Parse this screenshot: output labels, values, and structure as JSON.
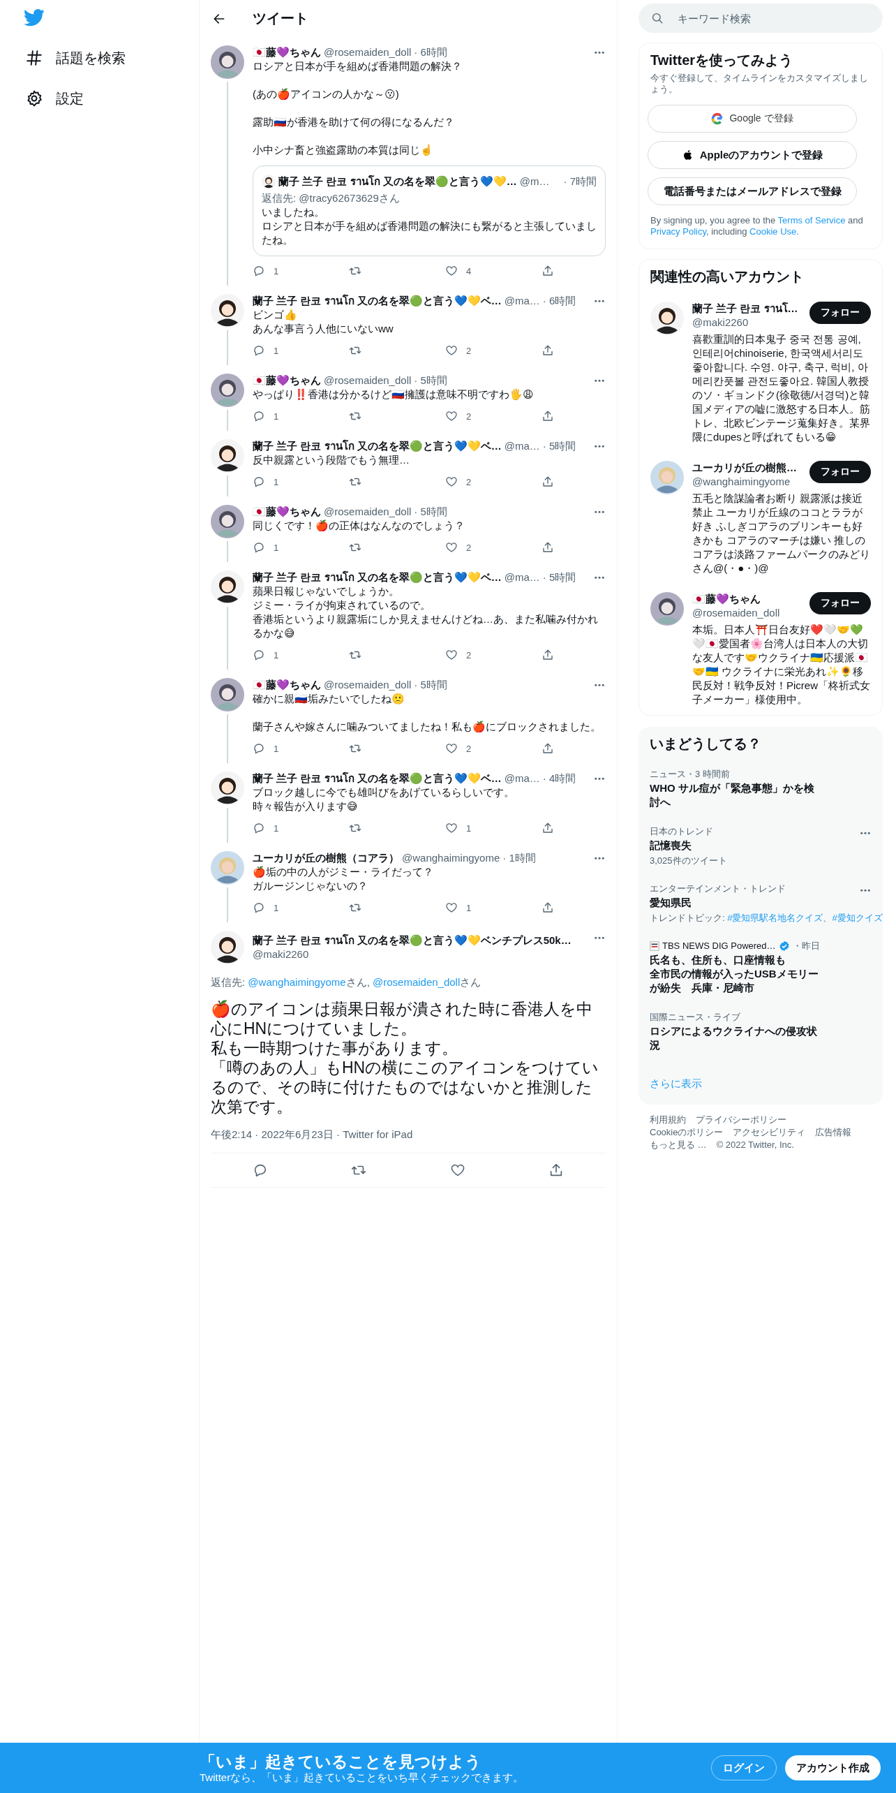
{
  "sidebar": {
    "items": [
      {
        "label": "話題を検索",
        "kind": "hashtag"
      },
      {
        "label": "設定",
        "kind": "settings"
      }
    ]
  },
  "header": {
    "title": "ツイート"
  },
  "thread": [
    {
      "avatar": {
        "kind": "doll"
      },
      "name": "🇯🇵藤💜ちゃん",
      "handle": "@rosemaiden_doll",
      "time": "· 6時間",
      "text": [
        [
          "ロシアと日本が手を組めば香港問題の解決？"
        ],
        [
          "(あの🍎アイコンの人かな～😗)"
        ],
        [
          "露助🇷🇺が香港を助けて何の得になるんだ？"
        ],
        [
          "小中シナ畜と強盗露助の本質は同じ☝️"
        ]
      ],
      "quote": {
        "avatar": {
          "kind": "maki"
        },
        "name": "蘭子 兰子 란코 รานโก 又の名を翠🟢と言う💙💛…",
        "handle": "@m…",
        "time": "· 7時間",
        "reply_to": "返信先: @tracy62673629さん",
        "text": [
          [
            "いましたね。",
            "ロシアと日本が手を組めば香港問題の解決にも繋がると主張していましたね。"
          ]
        ]
      },
      "replies": "1",
      "likes": "4"
    },
    {
      "avatar": {
        "kind": "maki"
      },
      "name": "蘭子 兰子 란코 รานโก 又の名を翠🟢と言う💙💛ベ…",
      "handle": "@ma…",
      "time": "· 6時間",
      "text": [
        [
          "ビンゴ👍",
          "あんな事言う人他にいないww"
        ]
      ],
      "replies": "1",
      "likes": "2"
    },
    {
      "avatar": {
        "kind": "doll"
      },
      "name": "🇯🇵藤💜ちゃん",
      "handle": "@rosemaiden_doll",
      "time": "· 5時間",
      "text": [
        [
          "やっぱり‼️香港は分かるけど🇷🇺擁護は意味不明ですわ🖐😩"
        ]
      ],
      "replies": "1",
      "likes": "2"
    },
    {
      "avatar": {
        "kind": "maki"
      },
      "name": "蘭子 兰子 란코 รานโก 又の名を翠🟢と言う💙💛ベ…",
      "handle": "@ma…",
      "time": "· 5時間",
      "text": [
        [
          "反中親露という段階でもう無理…"
        ]
      ],
      "replies": "1",
      "likes": "2"
    },
    {
      "avatar": {
        "kind": "doll"
      },
      "name": "🇯🇵藤💜ちゃん",
      "handle": "@rosemaiden_doll",
      "time": "· 5時間",
      "text": [
        [
          "同じくです！🍎の正体はなんなのでしょう？"
        ]
      ],
      "replies": "1",
      "likes": "2"
    },
    {
      "avatar": {
        "kind": "maki"
      },
      "name": "蘭子 兰子 란코 รานโก 又の名を翠🟢と言う💙💛ベ…",
      "handle": "@ma…",
      "time": "· 5時間",
      "text": [
        [
          "蘋果日報じゃないでしょうか。",
          "ジミー・ライが拘束されているので。",
          "香港垢というより親露垢にしか見えませんけどね…あ、また私噛み付かれるかな😅"
        ]
      ],
      "replies": "1",
      "likes": "2"
    },
    {
      "avatar": {
        "kind": "doll"
      },
      "name": "🇯🇵藤💜ちゃん",
      "handle": "@rosemaiden_doll",
      "time": "· 5時間",
      "text": [
        [
          "確かに親🇷🇺垢みたいでしたね🙁"
        ],
        [
          "蘭子さんや嫁さんに噛みついてましたね！私も🍎にブロックされました。"
        ]
      ],
      "replies": "1",
      "likes": "2"
    },
    {
      "avatar": {
        "kind": "maki"
      },
      "name": "蘭子 兰子 란코 รานโก 又の名を翠🟢と言う💙💛ベ…",
      "handle": "@ma…",
      "time": "· 4時間",
      "text": [
        [
          "ブロック越しに今でも雄叫びをあげているらしいです。",
          "時々報告が入ります😅"
        ]
      ],
      "replies": "1",
      "likes": "1"
    },
    {
      "avatar": {
        "kind": "koala"
      },
      "name": "ユーカリが丘の樹熊（コアラ）",
      "handle": "@wanghaimingyome",
      "time": "· 1時間",
      "text": [
        [
          "🍎垢の中の人がジミー・ライだって？",
          "ガルージンじゃないの？"
        ]
      ],
      "replies": "1",
      "likes": "1"
    }
  ],
  "focused": {
    "avatar": {
      "kind": "maki"
    },
    "name": "蘭子 兰子 란코 รานโก 又の名を翠🟢と言う💙💛ベンチプレス50k…",
    "handle": "@maki2260",
    "reply_to": [
      {
        "text": "返信先: ",
        "link": false
      },
      {
        "text": "@wanghaimingyome",
        "link": true
      },
      {
        "text": "さん, ",
        "link": false
      },
      {
        "text": "@rosemaiden_doll",
        "link": true
      },
      {
        "text": "さん",
        "link": false
      }
    ],
    "text": [
      [
        "🍎のアイコンは蘋果日報が潰された時に香港人を中心にHNにつけていました。",
        "私も一時期つけた事があります。",
        "「噂のあの人」もHNの横にこのアイコンをつけているので、その時に付けたものではないかと推測した次第です。"
      ]
    ],
    "meta": "午後2:14 · 2022年6月23日 · Twitter for iPad"
  },
  "search": {
    "placeholder": "キーワード検索"
  },
  "signup": {
    "title": "Twitterを使ってみよう",
    "subtitle": "今すぐ登録して、タイムラインをカスタマイズしましょう。",
    "buttons": [
      {
        "label": "Google で登録",
        "kind": "google"
      },
      {
        "label": "Appleのアカウントで登録",
        "kind": "apple"
      },
      {
        "label": "電話番号またはメールアドレスで登録",
        "kind": "plain"
      }
    ],
    "legal": [
      {
        "text": "By signing up, you agree to the ",
        "link": false
      },
      {
        "text": "Terms of Service",
        "link": true
      },
      {
        "text": " and ",
        "link": false
      },
      {
        "text": "Privacy Policy",
        "link": true
      },
      {
        "text": ", including ",
        "link": false
      },
      {
        "text": "Cookie Use.",
        "link": true
      }
    ]
  },
  "recommended": {
    "title": "関連性の高いアカウント",
    "accounts": [
      {
        "avatar": {
          "kind": "maki"
        },
        "name": "蘭子 兰子 란코 รานโ…",
        "handle": "@maki2260",
        "button": "フォロー",
        "bio": "喜歡重訓的日本鬼子 중국 전통 공예, 인테리어chinoiserie, 한국액세서리도 좋아합니다. 수영. 야구, 축구, 럭비, 아메리칸풋볼 관전도좋아요. 韓国人教授のソ・ギョンドク(徐敬徳/서경덕)と韓国メディアの嘘に激怒する日本人。筋トレ、北欧ビンテージ蒐集好き。某界隈にdupesと呼ばれてもいる😁"
      },
      {
        "avatar": {
          "kind": "koala"
        },
        "name": "ユーカリが丘の樹熊…",
        "handle": "@wanghaimingyome",
        "button": "フォロー",
        "bio": "五毛と陰謀論者お断り 親露派は接近禁止 ユーカリが丘線のココとララが好き ふしぎコアラのブリンキーも好きかも コアラのマーチは嫌い 推しのコアラは淡路ファームパークのみどりさん@(・●・)@"
      },
      {
        "avatar": {
          "kind": "doll"
        },
        "name": "🇯🇵藤💜ちゃん",
        "handle": "@rosemaiden_doll",
        "button": "フォロー",
        "bio": "本垢。日本人⛩️日台友好❤️🤍🤝💚🤍🇯🇵愛国者🌸台湾人は日本人の大切な友人です🤝ウクライナ🇺🇦応援派🇯🇵🤝🇺🇦 ウクライナに栄光あれ✨🌻移民反対！戦争反対！Picrew「柊祈式女子メーカー」様使用中。"
      }
    ]
  },
  "trends": {
    "title": "いまどうしてる？",
    "items": [
      {
        "kind": "news",
        "context": "ニュース・3 時間前",
        "title": [
          "WHO サル痘が「緊急事態」かを検討へ"
        ],
        "more": false
      },
      {
        "kind": "trend",
        "context": "日本のトレンド",
        "title": [
          "記憶喪失"
        ],
        "subtitle": "3,025件のツイート",
        "more": true
      },
      {
        "kind": "topics",
        "context": "エンターテインメント・トレンド",
        "title": [
          "愛知県民"
        ],
        "topics": [
          {
            "text": "トレンドトピック: ",
            "link": false
          },
          {
            "text": "#愛知県駅名地名クイズ",
            "link": true
          },
          {
            "text": "、",
            "link": false
          },
          {
            "text": "#愛知クイズ",
            "link": true
          }
        ],
        "more": true
      },
      {
        "kind": "source",
        "source": "TBS NEWS DIG Powered…",
        "verified": true,
        "context": "・昨日",
        "title": [
          "氏名も、住所も、口座情報も",
          "全市民の情報が入ったUSBメモリーが紛失　兵庫・尼崎市"
        ],
        "more": false
      },
      {
        "kind": "news",
        "context": "国際ニュース・ライブ",
        "title": [
          "ロシアによるウクライナへの侵攻状況"
        ],
        "more": false
      }
    ],
    "show_more": "さらに表示"
  },
  "footer": [
    "利用規約",
    "プライバシーポリシー",
    "Cookieのポリシー",
    "アクセシビリティ",
    "広告情報",
    "もっと見る …",
    "© 2022 Twitter, Inc."
  ],
  "banner": {
    "title": "「いま」起きていることを見つけよう",
    "subtitle": "Twitterなら、「いま」起きていることをいち早くチェックできます。",
    "login": "ログイン",
    "signup": "アカウント作成"
  }
}
